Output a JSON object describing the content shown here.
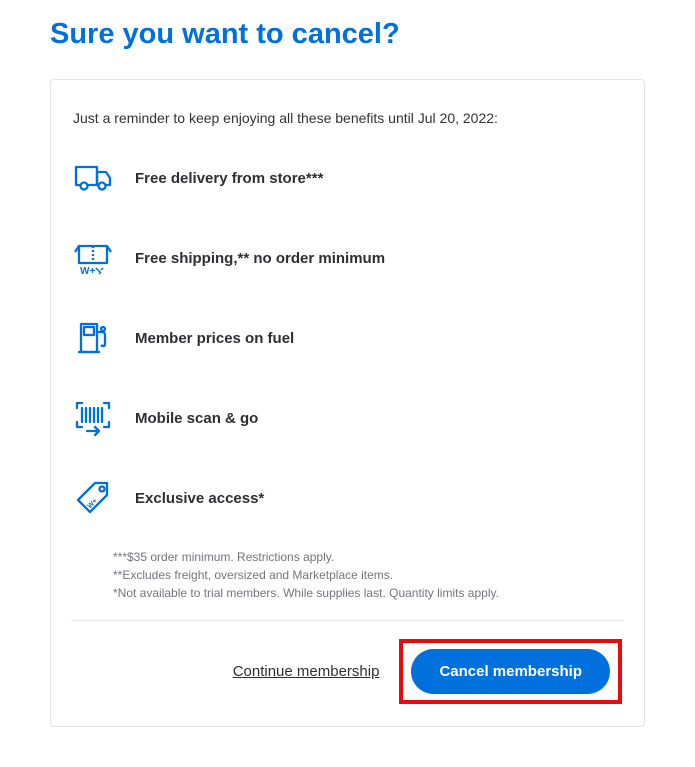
{
  "title": "Sure you want to cancel?",
  "reminder": "Just a reminder to keep enjoying all these benefits until Jul 20, 2022:",
  "benefits": [
    {
      "label": "Free delivery from store***"
    },
    {
      "label": "Free shipping,** no order minimum"
    },
    {
      "label": "Member prices on fuel"
    },
    {
      "label": "Mobile scan & go"
    },
    {
      "label": "Exclusive access*"
    }
  ],
  "footnotes": [
    "***$35 order minimum. Restrictions apply.",
    "**Excludes freight, oversized and Marketplace items.",
    "*Not available to trial members. While supplies last. Quantity limits apply."
  ],
  "actions": {
    "continue_label": "Continue membership",
    "cancel_label": "Cancel membership"
  },
  "colors": {
    "accent": "#0071dc",
    "highlight": "#e70b0b"
  }
}
